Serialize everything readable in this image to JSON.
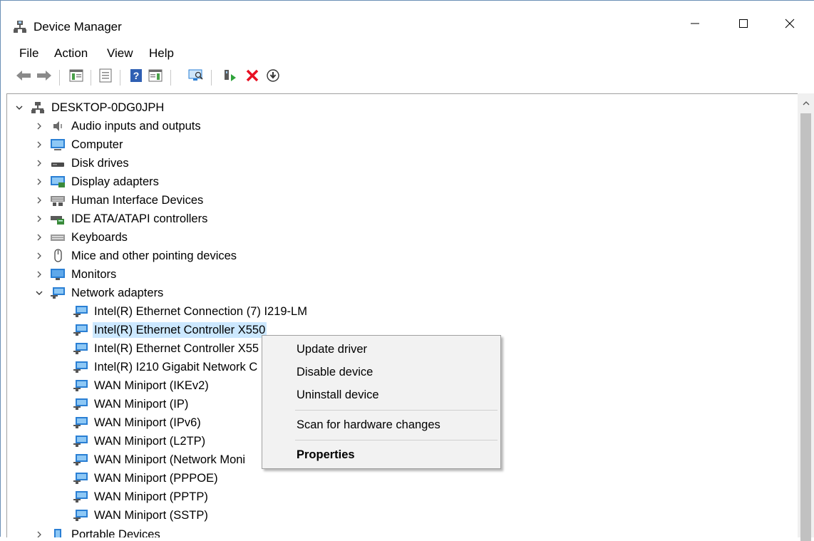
{
  "window": {
    "title": "Device Manager",
    "title_icon": "device-manager-icon",
    "controls": [
      "minimize-icon",
      "maximize-icon",
      "close-icon"
    ]
  },
  "menu": {
    "items": [
      {
        "label": "File"
      },
      {
        "label": "Action"
      },
      {
        "label": "View"
      },
      {
        "label": "Help"
      }
    ]
  },
  "toolbar": {
    "buttons": [
      {
        "icon": "back-arrow-icon"
      },
      {
        "icon": "forward-arrow-icon"
      },
      {
        "icon": "show-hide-console-tree-icon"
      },
      {
        "icon": "properties-icon"
      },
      {
        "icon": "help-icon"
      },
      {
        "icon": "show-hide-action-pane-icon"
      },
      {
        "icon": "scan-hardware-icon"
      },
      {
        "icon": "update-driver-icon"
      },
      {
        "icon": "uninstall-icon"
      },
      {
        "icon": "enable-device-icon"
      }
    ]
  },
  "tree": {
    "root": {
      "label": "DESKTOP-0DG0JPH",
      "icon": "computer-network-icon"
    },
    "items": [
      {
        "label": "Audio inputs and outputs",
        "icon": "speaker-icon"
      },
      {
        "label": "Computer",
        "icon": "computer-icon"
      },
      {
        "label": "Disk drives",
        "icon": "disk-drive-icon"
      },
      {
        "label": "Display adapters",
        "icon": "display-adapter-icon"
      },
      {
        "label": "Human Interface Devices",
        "icon": "hid-icon"
      },
      {
        "label": "IDE ATA/ATAPI controllers",
        "icon": "ide-controller-icon"
      },
      {
        "label": "Keyboards",
        "icon": "keyboard-icon"
      },
      {
        "label": "Mice and other pointing devices",
        "icon": "mouse-icon"
      },
      {
        "label": "Monitors",
        "icon": "monitor-icon"
      },
      {
        "label": "Network adapters",
        "icon": "network-adapter-icon"
      }
    ],
    "network_children": [
      {
        "label": "Intel(R) Ethernet Connection (7) I219-LM",
        "icon": "network-adapter-icon"
      },
      {
        "label": "Intel(R) Ethernet Controller X550",
        "icon": "network-adapter-icon"
      },
      {
        "label": "Intel(R) Ethernet Controller X55",
        "icon": "network-adapter-icon"
      },
      {
        "label": "Intel(R) I210 Gigabit Network C",
        "icon": "network-adapter-icon"
      },
      {
        "label": "WAN Miniport (IKEv2)",
        "icon": "network-adapter-icon"
      },
      {
        "label": "WAN Miniport (IP)",
        "icon": "network-adapter-icon"
      },
      {
        "label": "WAN Miniport (IPv6)",
        "icon": "network-adapter-icon"
      },
      {
        "label": "WAN Miniport (L2TP)",
        "icon": "network-adapter-icon"
      },
      {
        "label": "WAN Miniport (Network Moni",
        "icon": "network-adapter-icon"
      },
      {
        "label": "WAN Miniport (PPPOE)",
        "icon": "network-adapter-icon"
      },
      {
        "label": "WAN Miniport (PPTP)",
        "icon": "network-adapter-icon"
      },
      {
        "label": "WAN Miniport (SSTP)",
        "icon": "network-adapter-icon"
      }
    ],
    "after": [
      {
        "label": "Portable Devices",
        "icon": "portable-device-icon"
      }
    ]
  },
  "context_menu": {
    "items": [
      {
        "label": "Update driver"
      },
      {
        "label": "Disable device"
      },
      {
        "label": "Uninstall device"
      },
      {
        "label": "Scan for hardware changes"
      },
      {
        "label": "Properties"
      }
    ]
  },
  "colors": {
    "selection": "#cce8ff",
    "network_icon": "#2a7fd4",
    "uninstall_red": "#e81123",
    "scrollbar_thumb": "#c1c1c1"
  }
}
